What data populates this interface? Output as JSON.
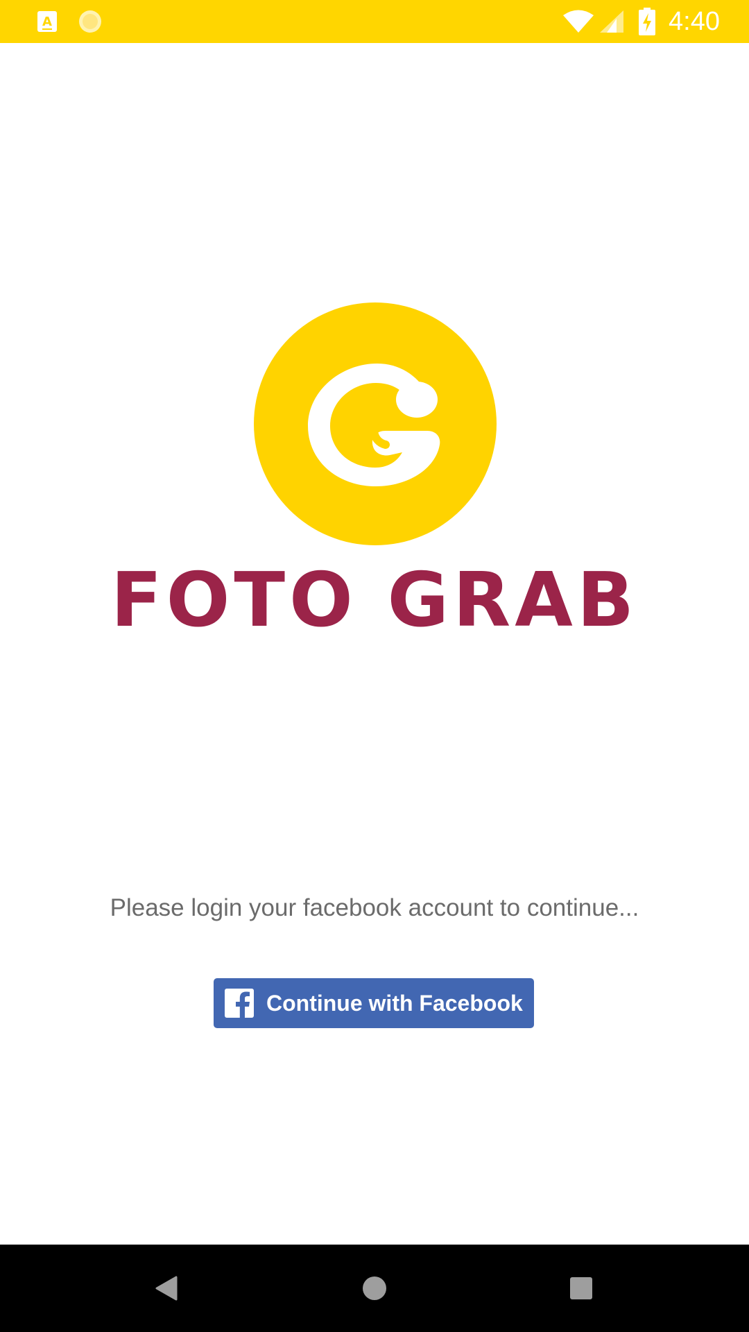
{
  "status_bar": {
    "time": "4:40",
    "icons": [
      "app-notification-icon",
      "sun-icon",
      "wifi-icon",
      "cellular-signal-icon",
      "battery-charging-icon"
    ],
    "background_color": "#FFD600"
  },
  "logo": {
    "letter": "G",
    "wordmark": "FOTO GRAB",
    "circle_color": "#FFD300",
    "wordmark_color": "#9B2449"
  },
  "login": {
    "prompt": "Please login your facebook account to continue...",
    "button_label": "Continue with Facebook",
    "button_icon": "facebook-icon",
    "button_color": "#4267B2"
  },
  "nav_bar": {
    "buttons": [
      "back-icon",
      "home-icon",
      "recents-icon"
    ]
  }
}
